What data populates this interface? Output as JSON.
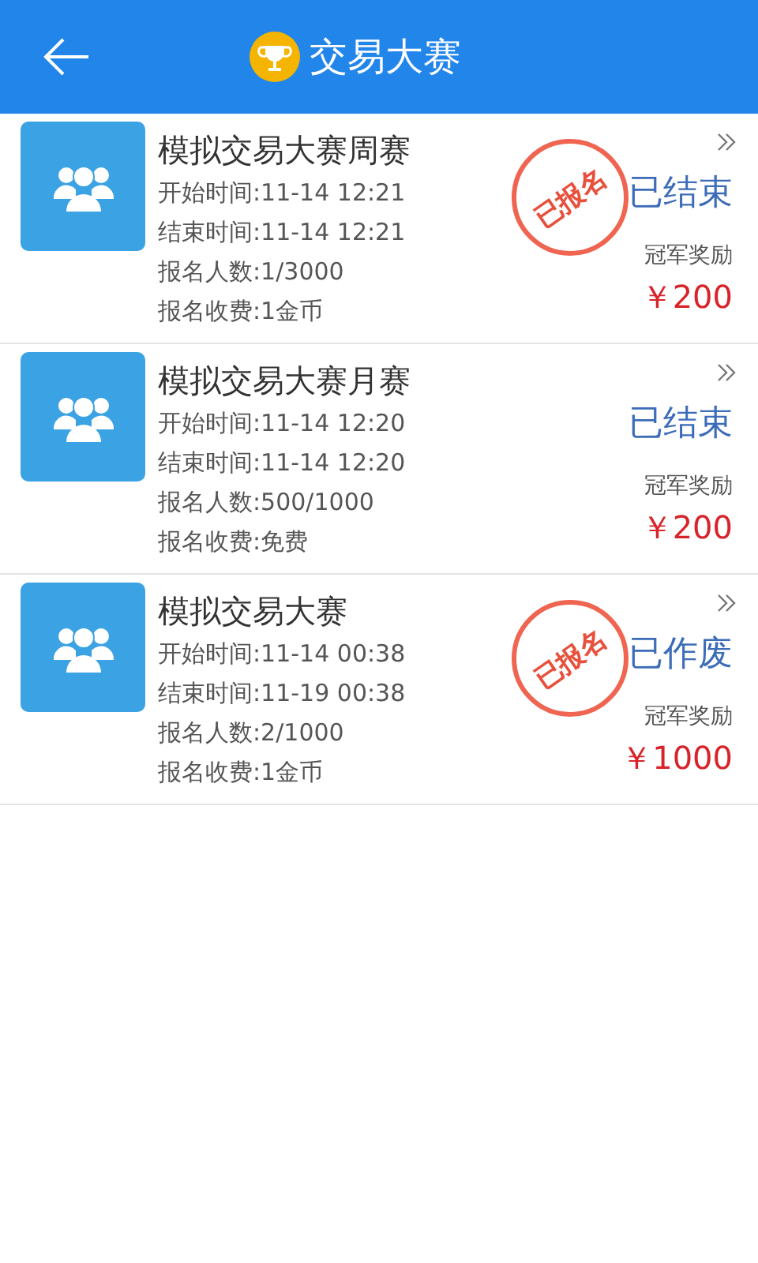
{
  "header": {
    "title": "交易大赛"
  },
  "contests": [
    {
      "name": "模拟交易大赛周赛",
      "start": "开始时间:11-14 12:21",
      "end": "结束时间:11-14 12:21",
      "signups": "报名人数:1/3000",
      "fee": "报名收费:1金币",
      "status": "已结束",
      "stamp": "已报名",
      "prize_label": "冠军奖励",
      "prize": "￥200"
    },
    {
      "name": "模拟交易大赛月赛",
      "start": "开始时间:11-14 12:20",
      "end": "结束时间:11-14 12:20",
      "signups": "报名人数:500/1000",
      "fee": "报名收费:免费",
      "status": "已结束",
      "prize_label": "冠军奖励",
      "prize": "￥200"
    },
    {
      "name": "模拟交易大赛",
      "start": "开始时间:11-14 00:38",
      "end": "结束时间:11-19 00:38",
      "signups": "报名人数:2/1000",
      "fee": "报名收费:1金币",
      "status": "已作废",
      "stamp": "已报名",
      "prize_label": "冠军奖励",
      "prize": "￥1000"
    }
  ]
}
